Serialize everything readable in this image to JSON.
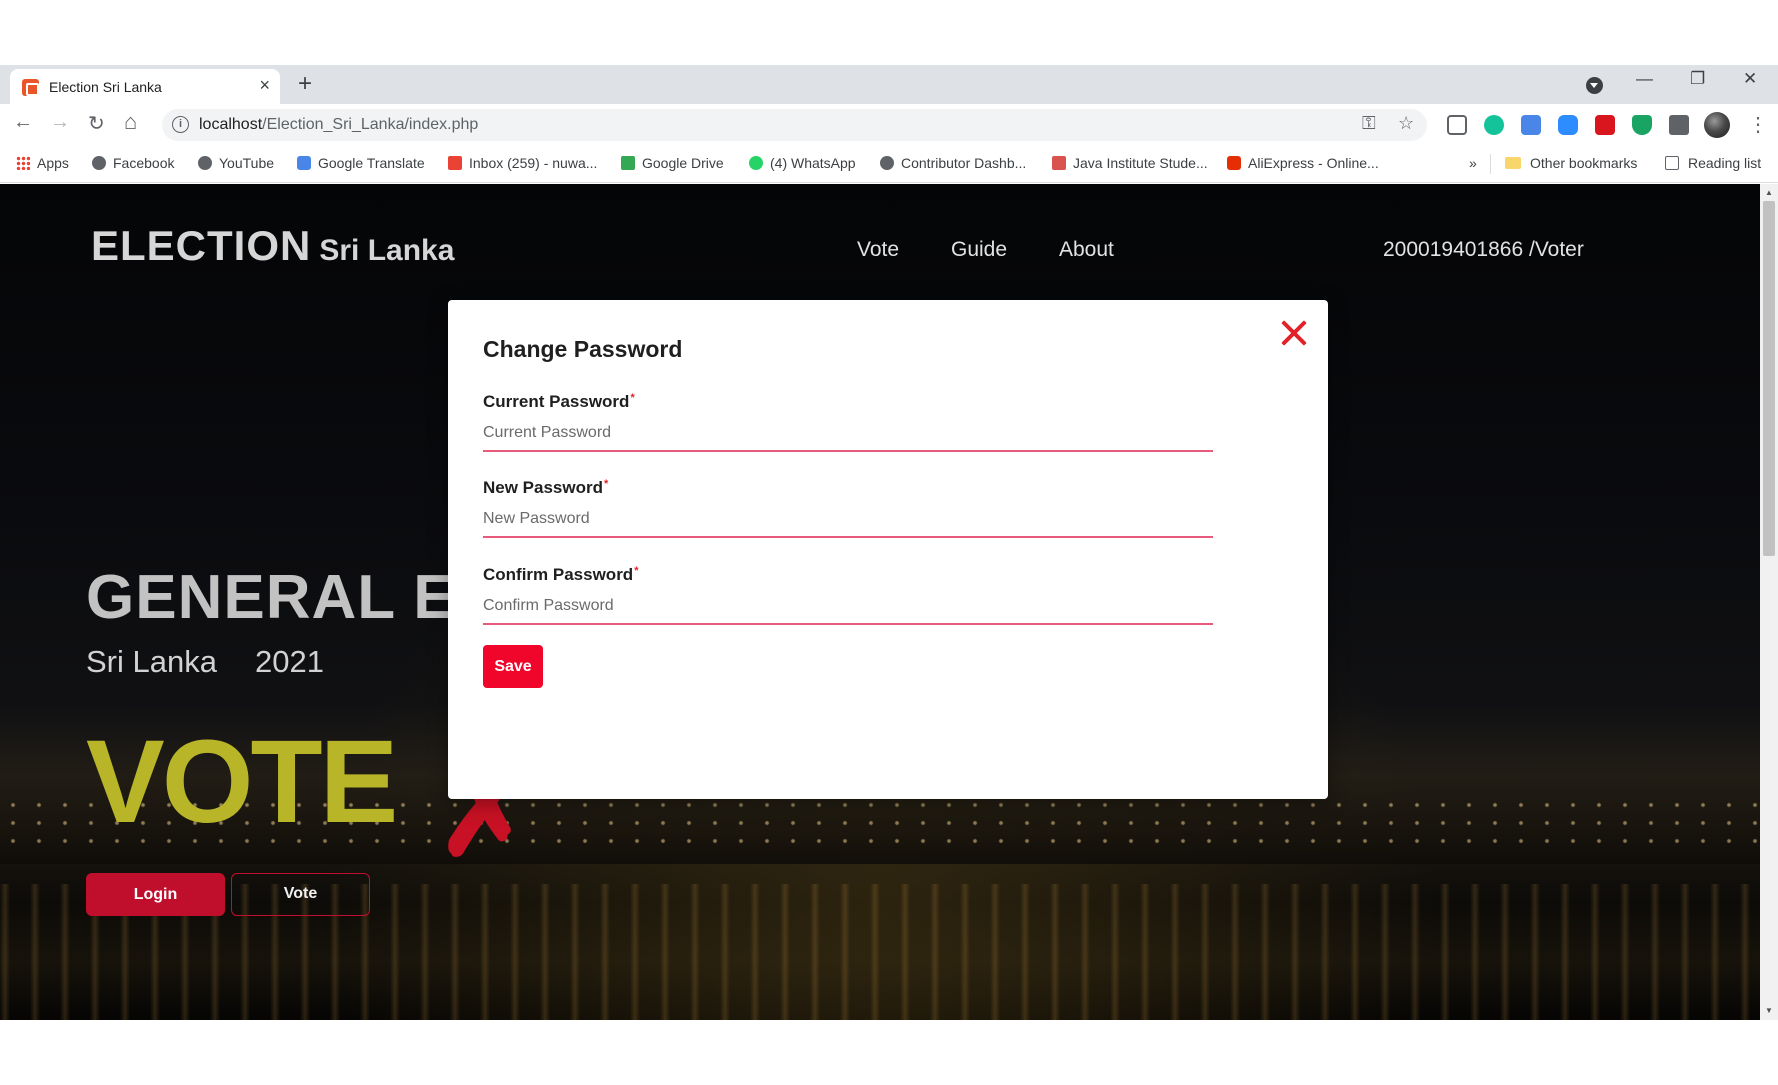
{
  "browser": {
    "tab_title": "Election Sri Lanka",
    "tab_close": "×",
    "new_tab": "+",
    "window_controls": {
      "minimize": "—",
      "restore": "❐",
      "close": "✕"
    },
    "url_host": "localhost",
    "url_path": "/Election_Sri_Lanka/index.php",
    "nav": {
      "back": "←",
      "forward": "→",
      "reload": "↻",
      "home": "⌂"
    },
    "bookmarks": [
      {
        "label": "Apps",
        "icon": "apps-grid-icon"
      },
      {
        "label": "Facebook",
        "icon": "globe-icon"
      },
      {
        "label": "YouTube",
        "icon": "globe-icon"
      },
      {
        "label": "Google Translate",
        "icon": "translate-icon"
      },
      {
        "label": "Inbox (259) - nuwa...",
        "icon": "gmail-icon"
      },
      {
        "label": "Google Drive",
        "icon": "drive-icon"
      },
      {
        "label": "(4) WhatsApp",
        "icon": "whatsapp-icon"
      },
      {
        "label": "Contributor Dashb...",
        "icon": "globe-icon"
      },
      {
        "label": "Java Institute Stude...",
        "icon": "java-icon"
      },
      {
        "label": "AliExpress - Online...",
        "icon": "aliexpress-icon"
      }
    ],
    "bookmarks_overflow": "»",
    "other_bookmarks": "Other bookmarks",
    "reading_list": "Reading list"
  },
  "site": {
    "brand_main": "ELECTION",
    "brand_sub": "Sri Lanka",
    "nav": [
      "Vote",
      "Guide",
      "About"
    ],
    "user": "200019401866 /Voter"
  },
  "hero": {
    "title": "GENERAL ELI",
    "country": "Sri Lanka",
    "year": "2021",
    "vote_word": "VOTE",
    "login_button": "Login",
    "vote_button": "Vote"
  },
  "modal": {
    "title": "Change Password",
    "required_mark": "*",
    "fields": [
      {
        "label": "Current Password",
        "placeholder": "Current Password",
        "value": ""
      },
      {
        "label": "New Password",
        "placeholder": "New Password",
        "value": ""
      },
      {
        "label": "Confirm Password",
        "placeholder": "Confirm Password",
        "value": ""
      }
    ],
    "save_button": "Save"
  },
  "colors": {
    "accent_red": "#f0062b",
    "hero_vote_olive": "#b8b628",
    "input_underline": "#e85a7c"
  }
}
